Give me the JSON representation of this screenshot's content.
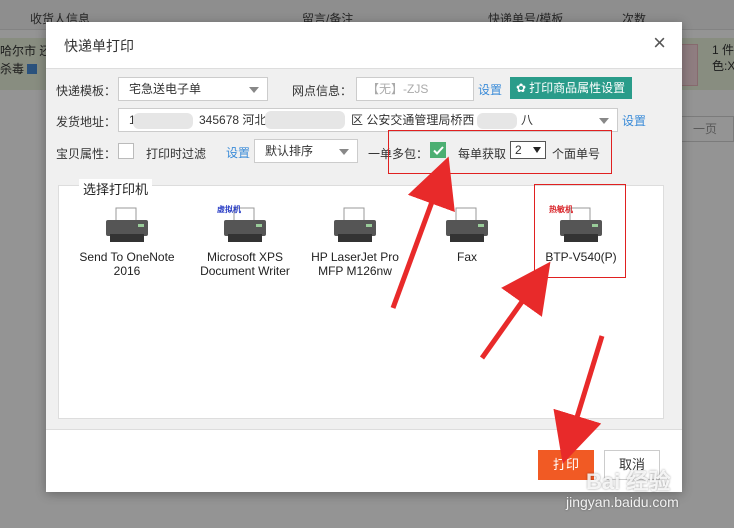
{
  "background": {
    "col_receiver": "收货人信息",
    "col_note": "留言/备注",
    "col_tracking": "快递单号/模板",
    "col_count": "次数",
    "row_left_line1": "哈尔市 还",
    "row_left_line2": "杀毒",
    "row_right_line1": "1 件",
    "row_right_line2": "色:X",
    "page_btn": "一页"
  },
  "dialog": {
    "title": "快递单打印",
    "close_icon": "close-icon",
    "template_label": "快递模板：",
    "template_value": "宅急送电子单",
    "branch_label": "网点信息：",
    "branch_placeholder": "【无】-ZJS",
    "settings_link": "设置",
    "attr_button": "打印商品属性设置",
    "sender_label": "发货地址：",
    "sender_value_a": "1",
    "sender_value_b": "345678 河北",
    "sender_value_c": "区 公安交通管理局桥西",
    "sender_value_d": "八",
    "baby_label": "宝贝属性：",
    "print_filter_label": "打印时过滤",
    "sort_value": "默认排序",
    "multi_pack_label": "一单多包：",
    "per_order_label": "每单获取",
    "per_order_value": "2",
    "per_order_suffix": "个面单号",
    "printer_section_title": "选择打印机",
    "printers": [
      {
        "name_line1": "Send To OneNote",
        "name_line2": "2016",
        "tag": ""
      },
      {
        "name_line1": "Microsoft XPS",
        "name_line2": "Document Writer",
        "tag": "虚拟机"
      },
      {
        "name_line1": "HP LaserJet Pro",
        "name_line2": "MFP M126nw",
        "tag": ""
      },
      {
        "name_line1": "Fax",
        "name_line2": "",
        "tag": ""
      },
      {
        "name_line1": "BTP-V540(P)",
        "name_line2": "",
        "tag": "热敏机"
      }
    ],
    "print_button": "打印",
    "cancel_button": "取消"
  },
  "watermark": {
    "brand": "Bai 经验",
    "url": "jingyan.baidu.com"
  },
  "colors": {
    "accent_teal": "#2a9c8a",
    "print_orange": "#f15a24",
    "check_green": "#4caf72",
    "link_blue": "#3a8bd8",
    "annotation_red": "#e02020"
  }
}
